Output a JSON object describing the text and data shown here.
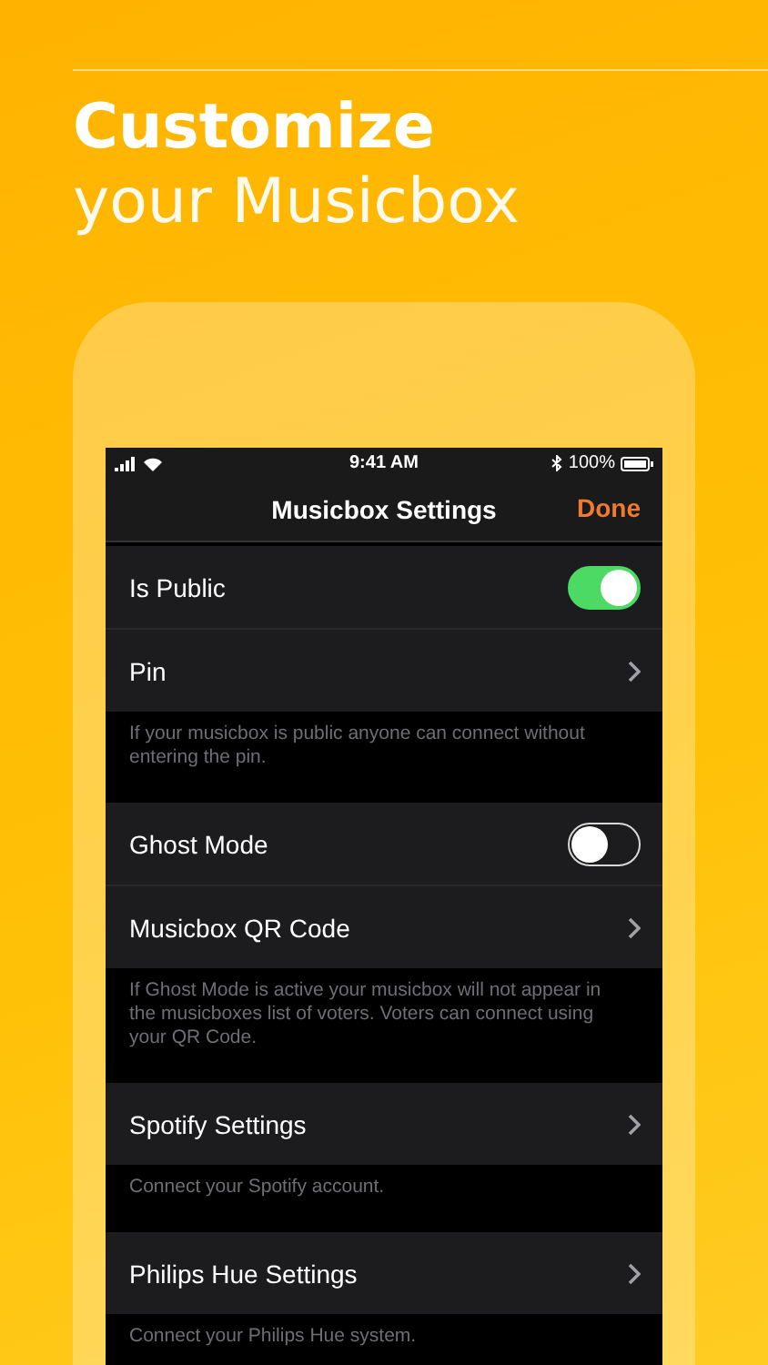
{
  "headline": {
    "title": "Customize",
    "subtitle": "your Musicbox"
  },
  "status_bar": {
    "time": "9:41 AM",
    "battery": "100%"
  },
  "nav_bar": {
    "title": "Musicbox Settings",
    "action": "Done"
  },
  "sections": [
    {
      "rows": [
        {
          "kind": "toggle",
          "label": "Is Public",
          "on": true
        },
        {
          "kind": "link",
          "label": "Pin"
        }
      ],
      "footer": "If your musicbox is public anyone can connect without entering the pin."
    },
    {
      "rows": [
        {
          "kind": "toggle",
          "label": "Ghost Mode",
          "on": false
        },
        {
          "kind": "link",
          "label": "Musicbox QR Code"
        }
      ],
      "footer": "If Ghost Mode is active your musicbox will not appear in the musicboxes list of voters. Voters can connect using your QR Code."
    },
    {
      "rows": [
        {
          "kind": "link",
          "label": "Spotify Settings"
        }
      ],
      "footer": "Connect your Spotify account."
    },
    {
      "rows": [
        {
          "kind": "link",
          "label": "Philips Hue Settings"
        }
      ],
      "footer": "Connect your Philips Hue system."
    }
  ]
}
